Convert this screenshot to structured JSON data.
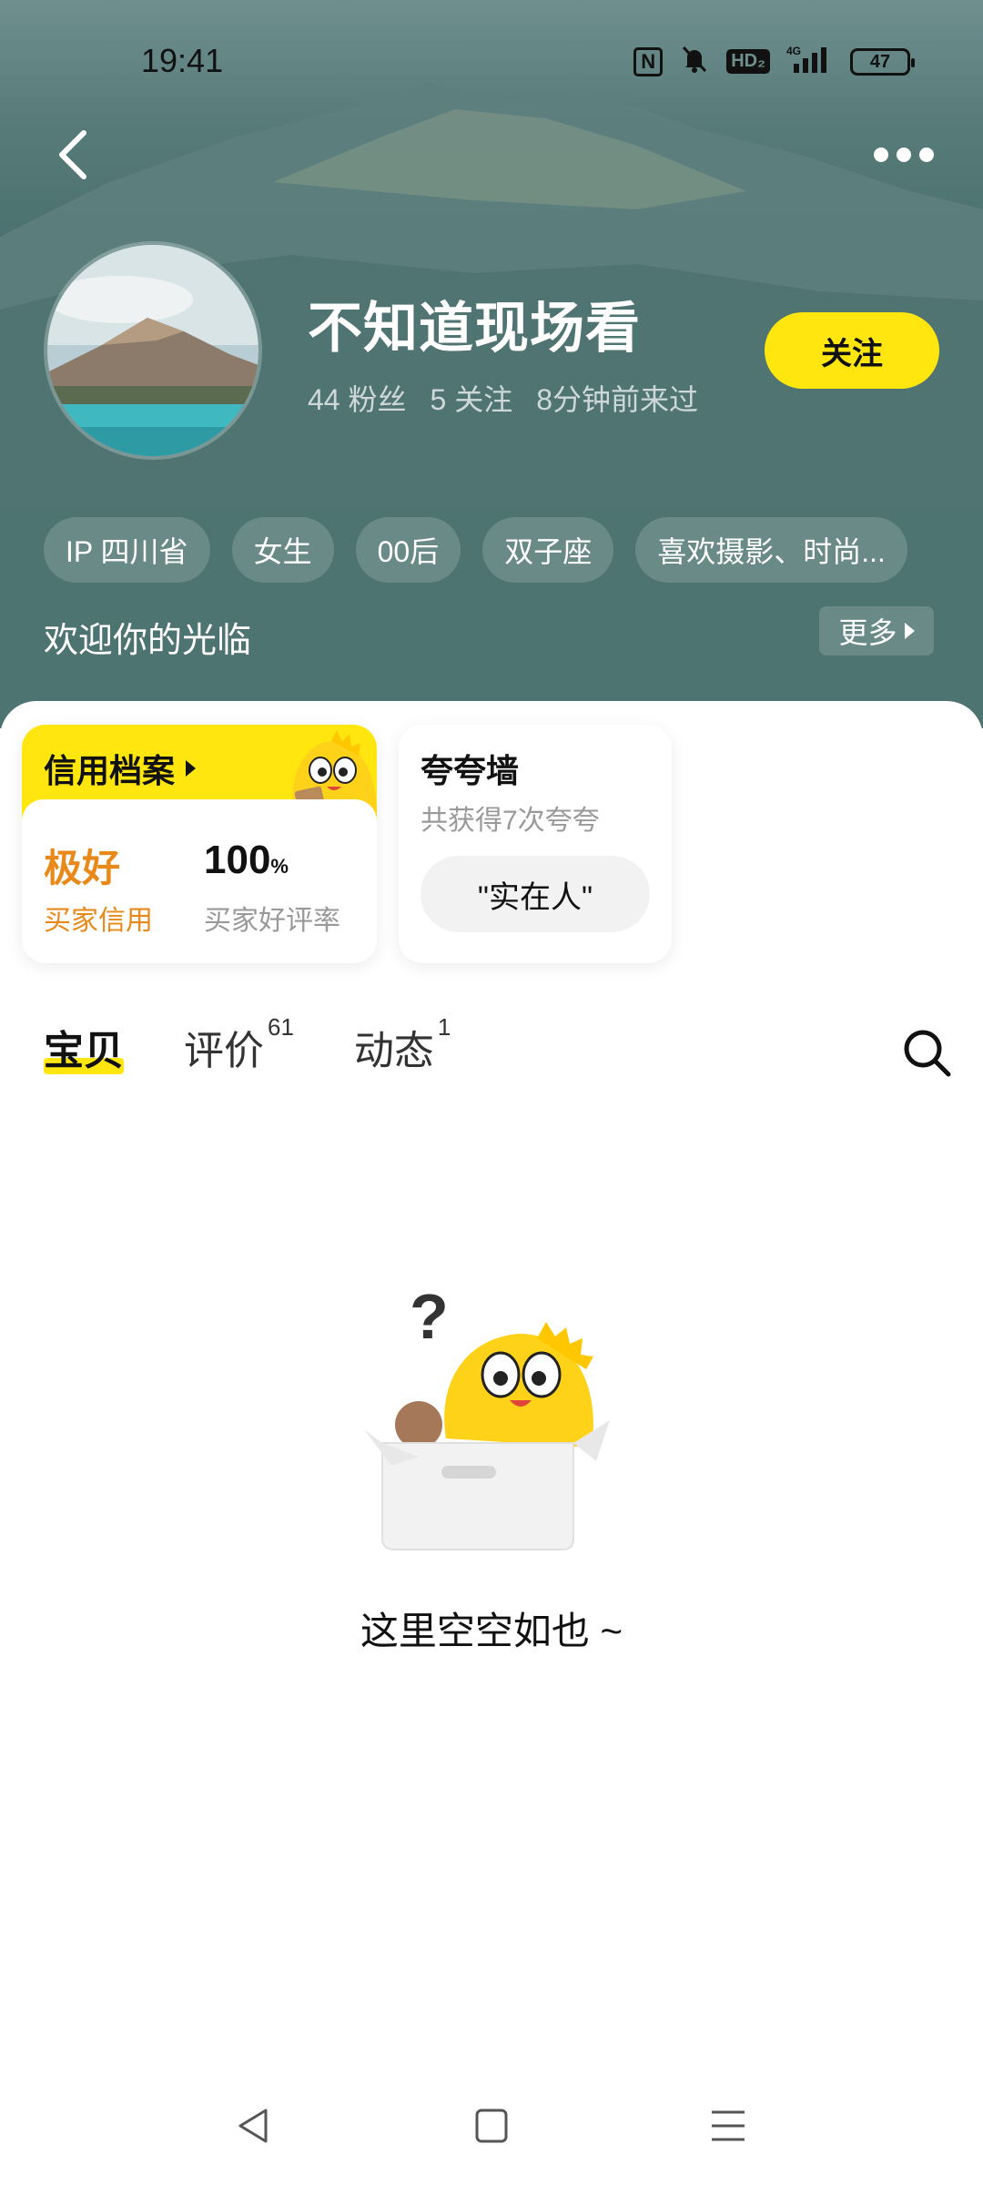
{
  "status_bar": {
    "time": "19:41",
    "hd_label": "HD₂",
    "network_label": "4G",
    "battery": "47"
  },
  "profile": {
    "name": "不知道现场看",
    "stats": [
      "44 粉丝",
      "5 关注",
      "8分钟前来过"
    ],
    "follow_label": "关注",
    "tags": [
      "IP 四川省",
      "女生",
      "00后",
      "双子座",
      "喜欢摄影、时尚..."
    ],
    "welcome": "欢迎你的光临",
    "more_label": "更多"
  },
  "credit_card": {
    "title": "信用档案",
    "rating_value": "极好",
    "rating_label": "买家信用",
    "praise_rate_value": "100",
    "praise_rate_unit": "%",
    "praise_rate_label": "买家好评率"
  },
  "praise_wall": {
    "title": "夸夸墙",
    "subtitle": "共获得7次夸夸",
    "chip": "\"实在人\""
  },
  "tabs": [
    {
      "label": "宝贝",
      "count": ""
    },
    {
      "label": "评价",
      "count": "61"
    },
    {
      "label": "动态",
      "count": "1"
    }
  ],
  "empty_state": {
    "message": "这里空空如也 ~"
  },
  "colors": {
    "accent_yellow": "#ffe60f",
    "credit_orange": "#e8891a",
    "hero_teal": "#3f6c6a"
  },
  "icons": {
    "back": "chevron-left-icon",
    "more": "more-dots-icon",
    "search": "search-icon",
    "nav_back": "nav-back-icon",
    "nav_home": "nav-home-icon",
    "nav_menu": "nav-menu-icon"
  }
}
